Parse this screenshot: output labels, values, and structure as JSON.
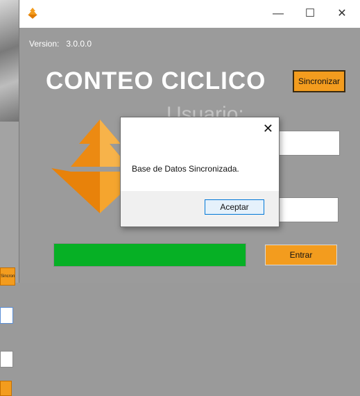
{
  "background": {
    "other_window_sync_label": "Sincronizar"
  },
  "window": {
    "version_label": "Version:",
    "version_value": "3.0.0.0",
    "title": "CONTEO CICLICO",
    "sync_button": "Sincronizar",
    "user_label": "Usuario:",
    "user_value": "",
    "password_value": "",
    "progress_fraction": 1.0,
    "enter_button": "Entrar",
    "controls": {
      "minimize": "—",
      "maximize": "☐",
      "close": "✕"
    }
  },
  "dialog": {
    "message": "Base de Datos Sincronizada.",
    "ok_button": "Aceptar",
    "close": "✕"
  },
  "colors": {
    "accent_orange": "#f39c1e",
    "progress_green": "#06b025",
    "window_gray": "#9b9b9b"
  }
}
